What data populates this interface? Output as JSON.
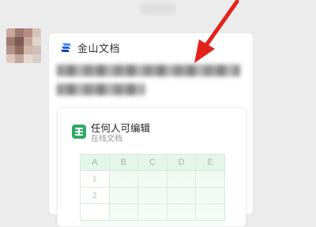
{
  "app": {
    "name": "金山文档",
    "brand_color": "#1f5fe0"
  },
  "message": {
    "title_obscured": true
  },
  "doc_card": {
    "title": "任何人可编辑",
    "subtitle": "在线文档",
    "icon": "spreadsheet-icon",
    "icon_color": "#2ea866"
  },
  "sheet": {
    "columns": [
      "A",
      "B",
      "C",
      "D",
      "E"
    ],
    "rows": [
      "1",
      "2"
    ],
    "accent_color": "#e4f5e9"
  },
  "annotation": {
    "arrow_icon": "red-arrow",
    "color": "#e2231a"
  }
}
